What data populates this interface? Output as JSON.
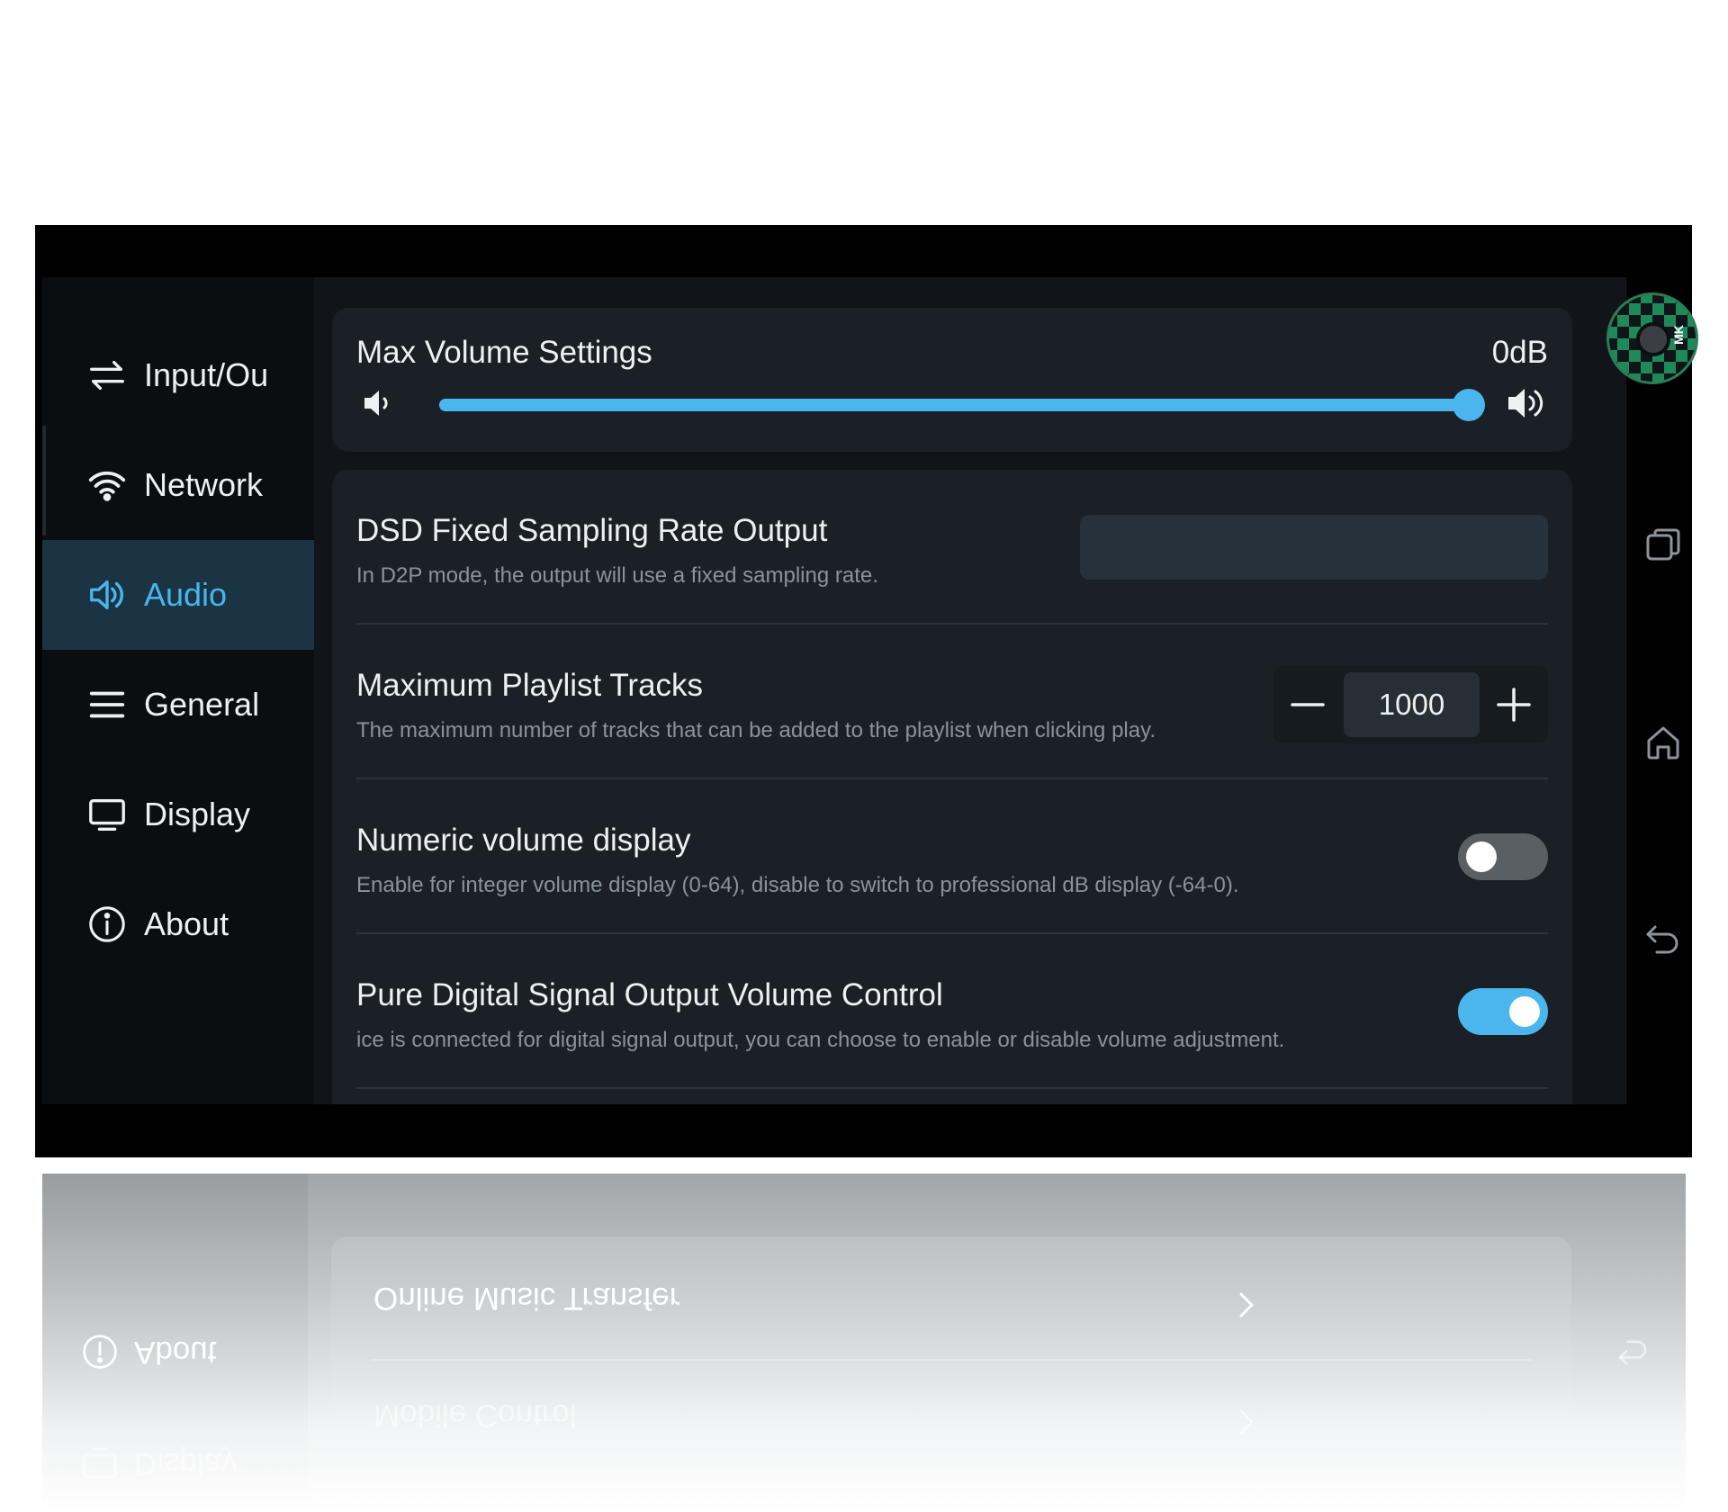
{
  "sidebar": {
    "items": [
      {
        "label": "Input/Ou",
        "icon": "input-output-icon",
        "active": false
      },
      {
        "label": "Network",
        "icon": "wifi-icon",
        "active": false
      },
      {
        "label": "Audio",
        "icon": "speaker-icon",
        "active": true
      },
      {
        "label": "General",
        "icon": "menu-icon",
        "active": false
      },
      {
        "label": "Display",
        "icon": "monitor-icon",
        "active": false
      },
      {
        "label": "About",
        "icon": "info-icon",
        "active": false
      }
    ]
  },
  "volume": {
    "title": "Max Volume Settings",
    "value": "0dB",
    "level_fraction": 1.0
  },
  "settings": {
    "dsd": {
      "title": "DSD Fixed Sampling Rate Output",
      "description": "In D2P mode, the output will use a fixed sampling rate.",
      "selected_value": ""
    },
    "playlist": {
      "title": "Maximum Playlist Tracks",
      "description": "The maximum number of tracks that can be added to the playlist when clicking play.",
      "value": "1000"
    },
    "numeric_volume": {
      "title": "Numeric volume display",
      "description": "Enable for integer volume display (0-64), disable to switch to professional dB display (-64-0).",
      "enabled": false
    },
    "pure_digital": {
      "title": "Pure Digital Signal Output Volume Control",
      "description": "ice is connected for digital signal output, you can choose to enable or disable volume adjustment.",
      "enabled": true
    }
  },
  "system_bar": {
    "avatar_label": "MK",
    "icons": [
      "recents-icon",
      "home-icon",
      "back-icon"
    ]
  },
  "reflection": {
    "items": [
      "Online Music Transfer",
      "Mobile Control"
    ],
    "sidebar_items": [
      "About",
      "Display"
    ]
  },
  "colors": {
    "accent": "#4ab6ed",
    "background": "#111519",
    "sidebar": "#0b0e11",
    "active_nav": "#1b3444",
    "card": "#1a2026"
  }
}
